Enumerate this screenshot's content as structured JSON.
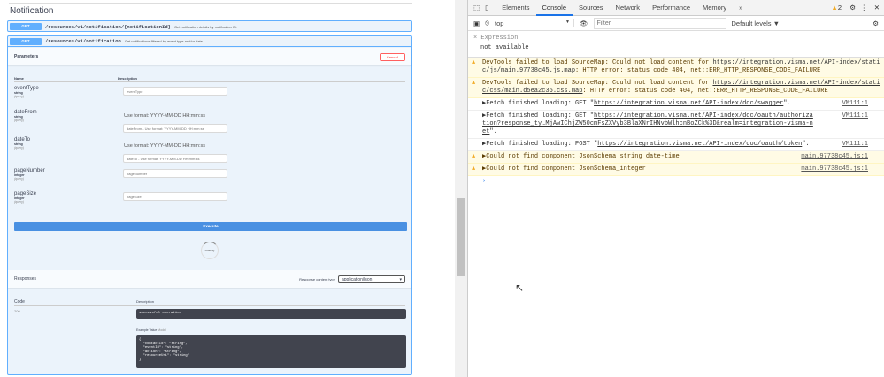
{
  "swagger": {
    "section_title": "Notification",
    "ops": [
      {
        "method": "GET",
        "path": "/resources/v1/notification/{notificationId}",
        "summary": "Get notification details by notification ID."
      },
      {
        "method": "GET",
        "path": "/resources/v1/notification",
        "summary": "Get notifications filtered by event type and/or date."
      }
    ],
    "parameters_label": "Parameters",
    "cancel_label": "Cancel",
    "col_name": "Name",
    "col_description": "Description",
    "params": [
      {
        "name": "eventType",
        "type": "string",
        "in": "(query)",
        "placeholder": "eventType",
        "format": ""
      },
      {
        "name": "dateFrom",
        "type": "string",
        "in": "(query)",
        "placeholder": "dateFrom - Use format: YYYY-MM-DD HH:mm:ss",
        "format": "Use format: YYYY-MM-DD HH:mm:ss"
      },
      {
        "name": "dateTo",
        "type": "string",
        "in": "(query)",
        "placeholder": "dateTo - Use format: YYYY-MM-DD HH:mm:ss",
        "format": "Use format: YYYY-MM-DD HH:mm:ss"
      },
      {
        "name": "pageNumber",
        "type": "integer",
        "in": "(query)",
        "placeholder": "pageNumber",
        "format": ""
      },
      {
        "name": "pageSize",
        "type": "integer",
        "in": "(query)",
        "placeholder": "pageSize",
        "format": ""
      }
    ],
    "execute_label": "Execute",
    "loading_label": "Loading",
    "responses_label": "Responses",
    "content_type_label": "Response content type",
    "content_type": "application/json",
    "col_code": "Code",
    "code": "200",
    "response_desc": "successful operation",
    "example_value": "Example Value",
    "model": "Model",
    "example": "{\n  \"contactId\": \"string\",\n  \"eventId\": \"string\",\n  \"action\": \"string\",\n  \"resourceUri\": \"string\"\n}"
  },
  "devtools": {
    "tabs": [
      "Elements",
      "Console",
      "Sources",
      "Network",
      "Performance",
      "Memory"
    ],
    "more": "»",
    "warn_count": "2",
    "context": "top",
    "filter_placeholder": "Filter",
    "levels": "Default levels ▼",
    "expression_label": "Expression",
    "expression_value": "not available",
    "messages": [
      {
        "level": "warn",
        "text": "DevTools failed to load SourceMap: Could not load content for ",
        "link": "https://integration.visma.net/API-index/static/js/main.97738c45.js.map",
        "rest": ": HTTP error: status code 404, net::ERR_HTTP_RESPONSE_CODE_FAILURE",
        "source": ""
      },
      {
        "level": "warn",
        "text": "DevTools failed to load SourceMap: Could not load content for ",
        "link": "https://integration.visma.net/API-index/static/css/main.d5ea2c36.css.map",
        "rest": ": HTTP error: status code 404, net::ERR_HTTP_RESPONSE_CODE_FAILURE",
        "source": ""
      },
      {
        "level": "info",
        "text": "▶Fetch finished loading: GET \"",
        "link": "https://integration.visma.net/API-index/doc/swagger",
        "rest": "\".",
        "source": "VM111:1"
      },
      {
        "level": "info",
        "text": "▶Fetch finished loading: GET \"",
        "link": "https://integration.visma.net/API-index/doc/oauth/authorization?response_ty…MjAwIChjZW50cmFsZXVyb3BlaXNrIHNvbWlhcnBoZCk%3D&realm=integration-visma-net",
        "rest": "\".",
        "source": "VM111:1"
      },
      {
        "level": "info",
        "text": "▶Fetch finished loading: POST \"",
        "link": "https://integration.visma.net/API-index/doc/oauth/token",
        "rest": "\".",
        "source": "VM111:1"
      },
      {
        "level": "warn",
        "text": "▶Could not find component JsonSchema_string_date-time",
        "link": "",
        "rest": "",
        "source": "main.97738c45.js:1"
      },
      {
        "level": "warn",
        "text": "▶Could not find component JsonSchema_integer",
        "link": "",
        "rest": "",
        "source": "main.97738c45.js:1"
      }
    ],
    "prompt": "›"
  }
}
